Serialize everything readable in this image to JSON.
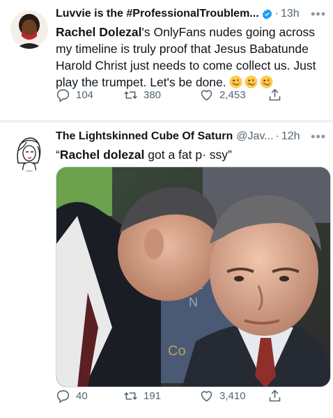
{
  "tweet1": {
    "author_name": "Luvvie is the #ProfessionalTroublem...",
    "separator": "·",
    "time": "13h",
    "text_bold": "Rachel Dolezal",
    "text_rest": "'s OnlyFans nudes going across my timeline is truly proof that Jesus Babatunde Harold Christ just needs to come collect us. Just play the trumpet. Let's be done.",
    "emojis": [
      "woozy-face",
      "woozy-face",
      "woozy-face"
    ],
    "replies": "104",
    "retweets": "380",
    "likes": "2,453"
  },
  "tweet2": {
    "author_name": "The Lightskinned Cube Of Saturn",
    "handle": "@Jav...",
    "separator": "·",
    "time": "12h",
    "text_open": "“",
    "text_bold": "Rachel dolezal",
    "text_rest": " got a fat p· ѕsy”",
    "media_sign_text": [
      "RE",
      "N",
      "Co"
    ],
    "replies": "40",
    "retweets": "191",
    "likes": "3,410"
  },
  "colors": {
    "text": "#0f1419",
    "secondary": "#536471",
    "verified": "#1d9bf0",
    "divider": "#eff3f4"
  }
}
